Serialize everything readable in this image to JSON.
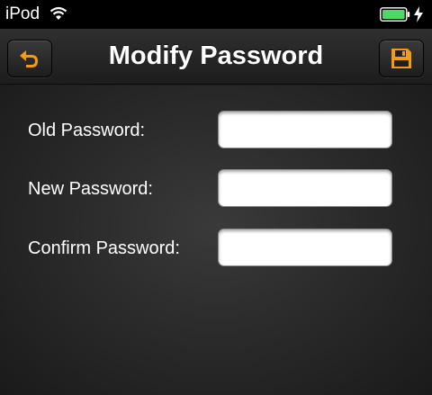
{
  "status_bar": {
    "carrier": "iPod",
    "wifi_icon": "wifi-icon",
    "battery_icon": "battery-icon",
    "battery_level": 1.0,
    "charging_icon": "charging-bolt-icon",
    "battery_color": "#4cd964"
  },
  "nav": {
    "title": "Modify Password",
    "back_icon": "undo-arrow-icon",
    "save_icon": "floppy-disk-icon",
    "accent_color": "#f39c12"
  },
  "form": {
    "fields": [
      {
        "label": "Old Password:",
        "value": "",
        "placeholder": ""
      },
      {
        "label": "New Password:",
        "value": "",
        "placeholder": ""
      },
      {
        "label": "Confirm Password:",
        "value": "",
        "placeholder": ""
      }
    ]
  }
}
